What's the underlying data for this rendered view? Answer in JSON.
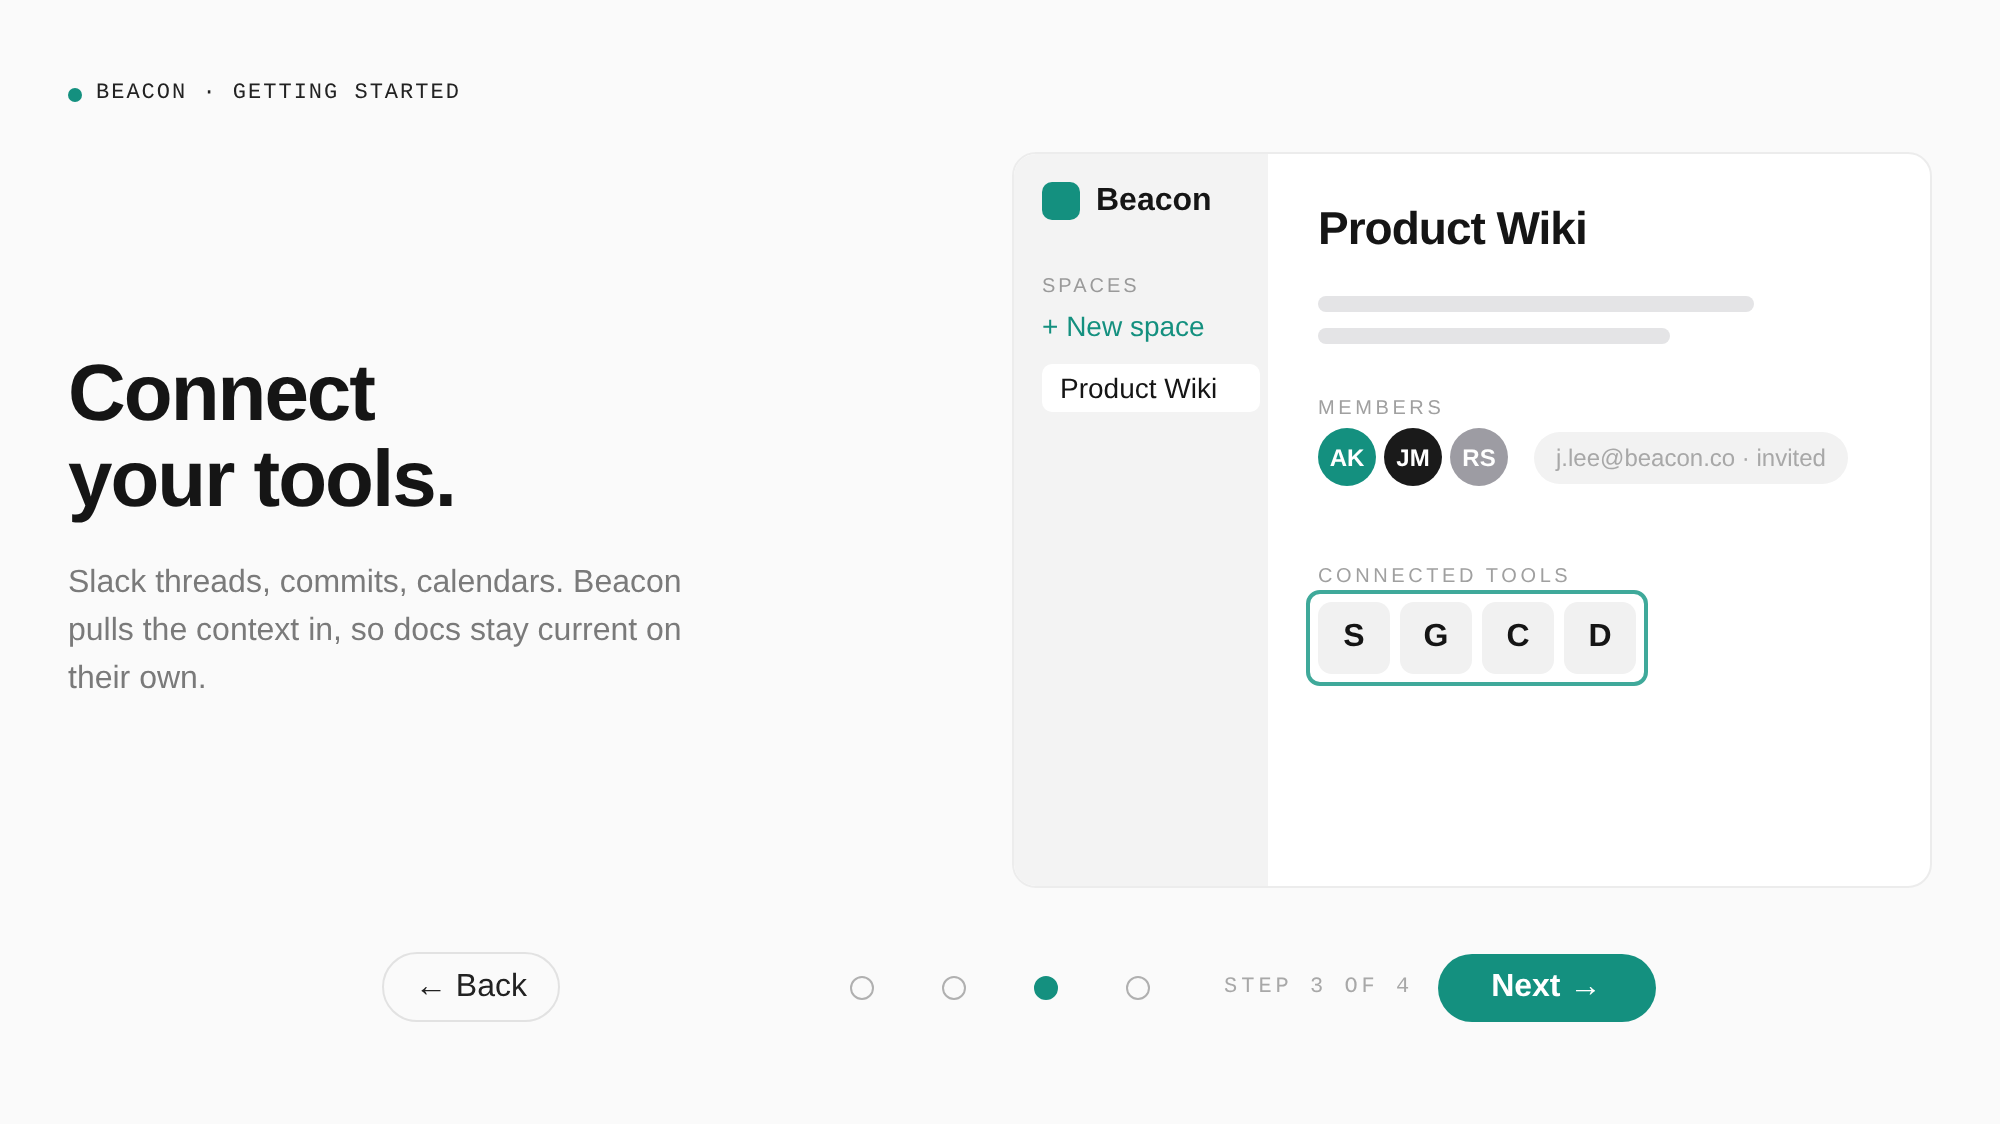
{
  "eyebrow": {
    "brand": "BEACON",
    "separator": "·",
    "section": "GETTING STARTED"
  },
  "headline": [
    "Connect",
    "your tools."
  ],
  "description": "Slack threads, commits, calendars. Beacon pulls the context in, so docs stay current on their own.",
  "preview": {
    "app_name": "Beacon",
    "sidebar": {
      "heading": "SPACES",
      "new_space": "+ New space",
      "items": [
        {
          "label": "Product Wiki",
          "selected": true
        }
      ]
    },
    "page_title": "Product Wiki",
    "members_label": "MEMBERS",
    "members": [
      {
        "initials": "AK",
        "color": "#14907f"
      },
      {
        "initials": "JM",
        "color": "#1a1a1a"
      },
      {
        "initials": "RS",
        "color": "#9d9ca3"
      }
    ],
    "invite": "j.lee@beacon.co · invited",
    "tools_label": "CONNECTED TOOLS",
    "tools": [
      "S",
      "G",
      "C",
      "D"
    ]
  },
  "footer": {
    "back": "← Back",
    "steps": [
      {
        "selected": false
      },
      {
        "selected": false
      },
      {
        "selected": true
      },
      {
        "selected": false
      }
    ],
    "step_text": "STEP 3 OF 4",
    "next": "Next →"
  }
}
